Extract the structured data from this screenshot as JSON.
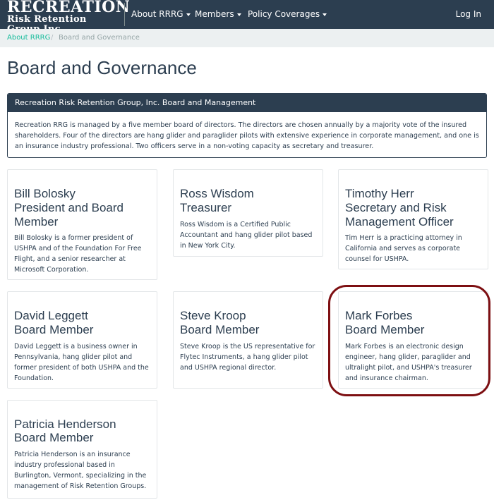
{
  "brand": {
    "line1": "RECREATION",
    "line2": "Risk Retention Group Inc."
  },
  "nav": {
    "items": [
      {
        "label": "About RRRG"
      },
      {
        "label": "Members"
      },
      {
        "label": "Policy Coverages"
      }
    ],
    "login": "Log In"
  },
  "breadcrumb": {
    "parent": "About RRRG",
    "separator": "/",
    "current": "Board and Governance"
  },
  "page": {
    "title": "Board and Governance"
  },
  "panel": {
    "heading": "Recreation Risk Retention Group, Inc. Board and Management",
    "body": "Recreation RRG is managed by a five member board of directors. The directors are chosen annually by a majority vote of the insured shareholders. Four of the directors are hang glider and paraglider pilots with extensive experience in corporate management, and one is an insurance industry professional. Two officers serve in a non-voting capacity as secretary and treasurer."
  },
  "members": [
    {
      "name": "Bill Bolosky",
      "role": "President and Board Member",
      "desc": "Bill Bolosky is a former president of USHPA and of the Foundation For Free Flight, and a senior researcher at Microsoft Corporation."
    },
    {
      "name": "Ross Wisdom",
      "role": "Treasurer",
      "desc": "Ross Wisdom is a Certified Public Accountant and hang glider pilot based in New York City."
    },
    {
      "name": "Timothy Herr",
      "role": "Secretary and Risk Management Officer",
      "desc": "Tim Herr is a practicing attorney in California and serves as corporate counsel for USHPA."
    },
    {
      "name": "David Leggett",
      "role": "Board Member",
      "desc": "David Leggett is a business owner in Pennsylvania, hang glider pilot and former president of both USHPA and the Foundation."
    },
    {
      "name": "Steve Kroop",
      "role": "Board Member",
      "desc": "Steve Kroop is the US representative for Flytec Instruments, a hang glider pilot and USHPA regional director."
    },
    {
      "name": "Mark Forbes",
      "role": "Board Member",
      "desc": "Mark Forbes is an electronic design engineer, hang glider, paraglider and ultralight pilot, and USHPA's treasurer and insurance chairman."
    },
    {
      "name": "Patricia Henderson",
      "role": "Board Member",
      "desc": "Patricia Henderson is an insurance industry professional based in Burlington, Vermont, specializing in the management of Risk Retention Groups."
    }
  ],
  "colors": {
    "navbar": "#2c3e50",
    "link": "#18bc9c",
    "highlight": "#7d0f12"
  }
}
